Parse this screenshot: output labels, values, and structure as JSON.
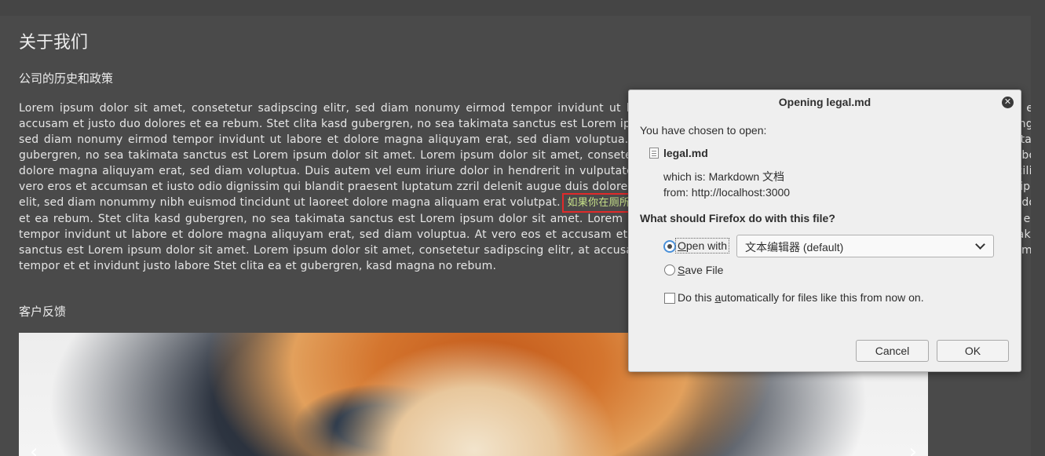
{
  "page": {
    "title": "关于我们",
    "history_heading": "公司的历史和政策",
    "lorem_before": "Lorem ipsum dolor sit amet, consetetur sadipscing elitr, sed diam nonumy eirmod tempor invidunt ut labore et dolore magna aliquyam erat, sed diam voluptua. At vero eos et accusam et justo duo dolores et ea rebum. Stet clita kasd gubergren, no sea takimata sanctus est Lorem ipsum dolor sit amet. Lorem ipsum dolor sit amet, consetetur sadipscing elitr, sed diam nonumy eirmod tempor invidunt ut labore et dolore magna aliquyam erat, sed diam voluptua. At vero eos et accusam et justo duo dolores et ea rebum. Stet clita kasd gubergren, no sea takimata sanctus est Lorem ipsum dolor sit amet. Lorem ipsum dolor sit amet, consetetur sadipscing elitr, sed diam nonumy eirmod tempor invidunt ut labore et dolore magna aliquyam erat, sed diam voluptua. Duis autem vel eum iriure dolor in hendrerit in vulputate velit esse molestie consequat, vel illum dolore eu feugiat nulla facilisis at vero eros et accumsan et iusto odio dignissim qui blandit praesent luptatum zzril delenit augue duis dolore te feugait nulla facilisi. Lorem ipsum dolor sit amet, consectetuer adipiscing elit, sed diam nonummy nibh euismod tincidunt ut laoreet dolore magna aliquam erat volutpat.",
    "highlight": "如果你在厕所闷得慌，就看看我们无聊的使用条款。",
    "lorem_after": "At vero eos et accusam et justo duo dolores et ea rebum. Stet clita kasd gubergren, no sea takimata sanctus est Lorem ipsum dolor sit amet. Lorem ipsum dolor sit amet, consetetur sadipscing elitr, sed diam nonumy eirmod tempor invidunt ut labore et dolore magna aliquyam erat, sed diam voluptua. At vero eos et accusam et justo duo dolores et ea rebum. Stet clita kasd gubergren, no sea takimata sanctus est Lorem ipsum dolor sit amet. Lorem ipsum dolor sit amet, consetetur sadipscing elitr, at accusam aliquyam diam diam dolore dolores duo eirmod eos erat, et nonumy sed tempor et et invidunt justo labore Stet clita ea et gubergren, kasd magna no rebum.",
    "feedback_heading": "客户反馈",
    "carousel": {
      "prev_icon": "‹",
      "next_icon": "›"
    }
  },
  "dialog": {
    "title": "Opening legal.md",
    "close_icon": "✕",
    "chosen_text": "You have chosen to open:",
    "filename": "legal.md",
    "which_is": "which is:  Markdown 文档",
    "from": "from:  http://localhost:3000",
    "question": "What should Firefox do with this file?",
    "open_with_pre": "O",
    "open_with_rest": "pen with",
    "open_with_app": "文本编辑器 (default)",
    "save_pre": "S",
    "save_rest": "ave File",
    "auto_pre": "Do this ",
    "auto_u": "a",
    "auto_rest": "utomatically for files like this from now on.",
    "cancel_label": "Cancel",
    "ok_label": "OK",
    "selected_option": "open_with",
    "auto_checked": false
  },
  "colors": {
    "page_bg": "#4a4a4a",
    "highlight_text": "#c6e089",
    "highlight_border": "#e02a2a",
    "dialog_bg": "#efefef"
  }
}
